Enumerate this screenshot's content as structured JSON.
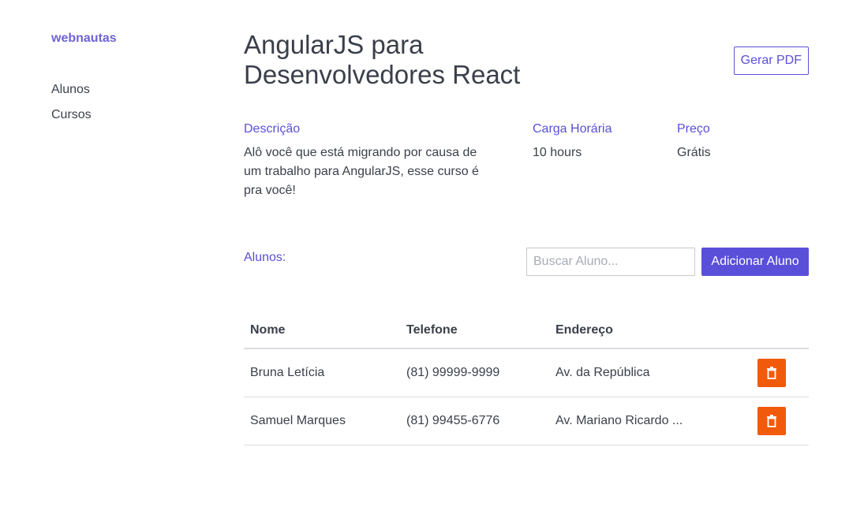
{
  "sidebar": {
    "brand": "webnautas",
    "items": [
      {
        "label": "Alunos"
      },
      {
        "label": "Cursos"
      }
    ]
  },
  "course": {
    "title": "AngularJS para Desenvolvedores React",
    "pdf_button_label": "Gerar PDF",
    "description_label": "Descrição",
    "description": "Alô você que está migrando por causa de um trabalho para AngularJS, esse curso é pra você!",
    "workload_label": "Carga Horária",
    "workload": "10 hours",
    "price_label": "Preço",
    "price": "Grátis"
  },
  "students": {
    "label": "Alunos:",
    "search_placeholder": "Buscar Aluno...",
    "add_button_label": "Adicionar Aluno",
    "columns": [
      "Nome",
      "Telefone",
      "Endereço"
    ],
    "rows": [
      {
        "name": "Bruna Letícia",
        "phone": "(81) 99999-9999",
        "address": "Av. da República"
      },
      {
        "name": "Samuel Marques",
        "phone": "(81) 99455-6776",
        "address": "Av. Mariano Ricardo ..."
      }
    ],
    "delete_icon": "trash-icon"
  },
  "colors": {
    "accent": "#5a4fd8",
    "brand": "#6f63d6",
    "danger": "#f25a0b",
    "text": "#3a3f4a"
  }
}
